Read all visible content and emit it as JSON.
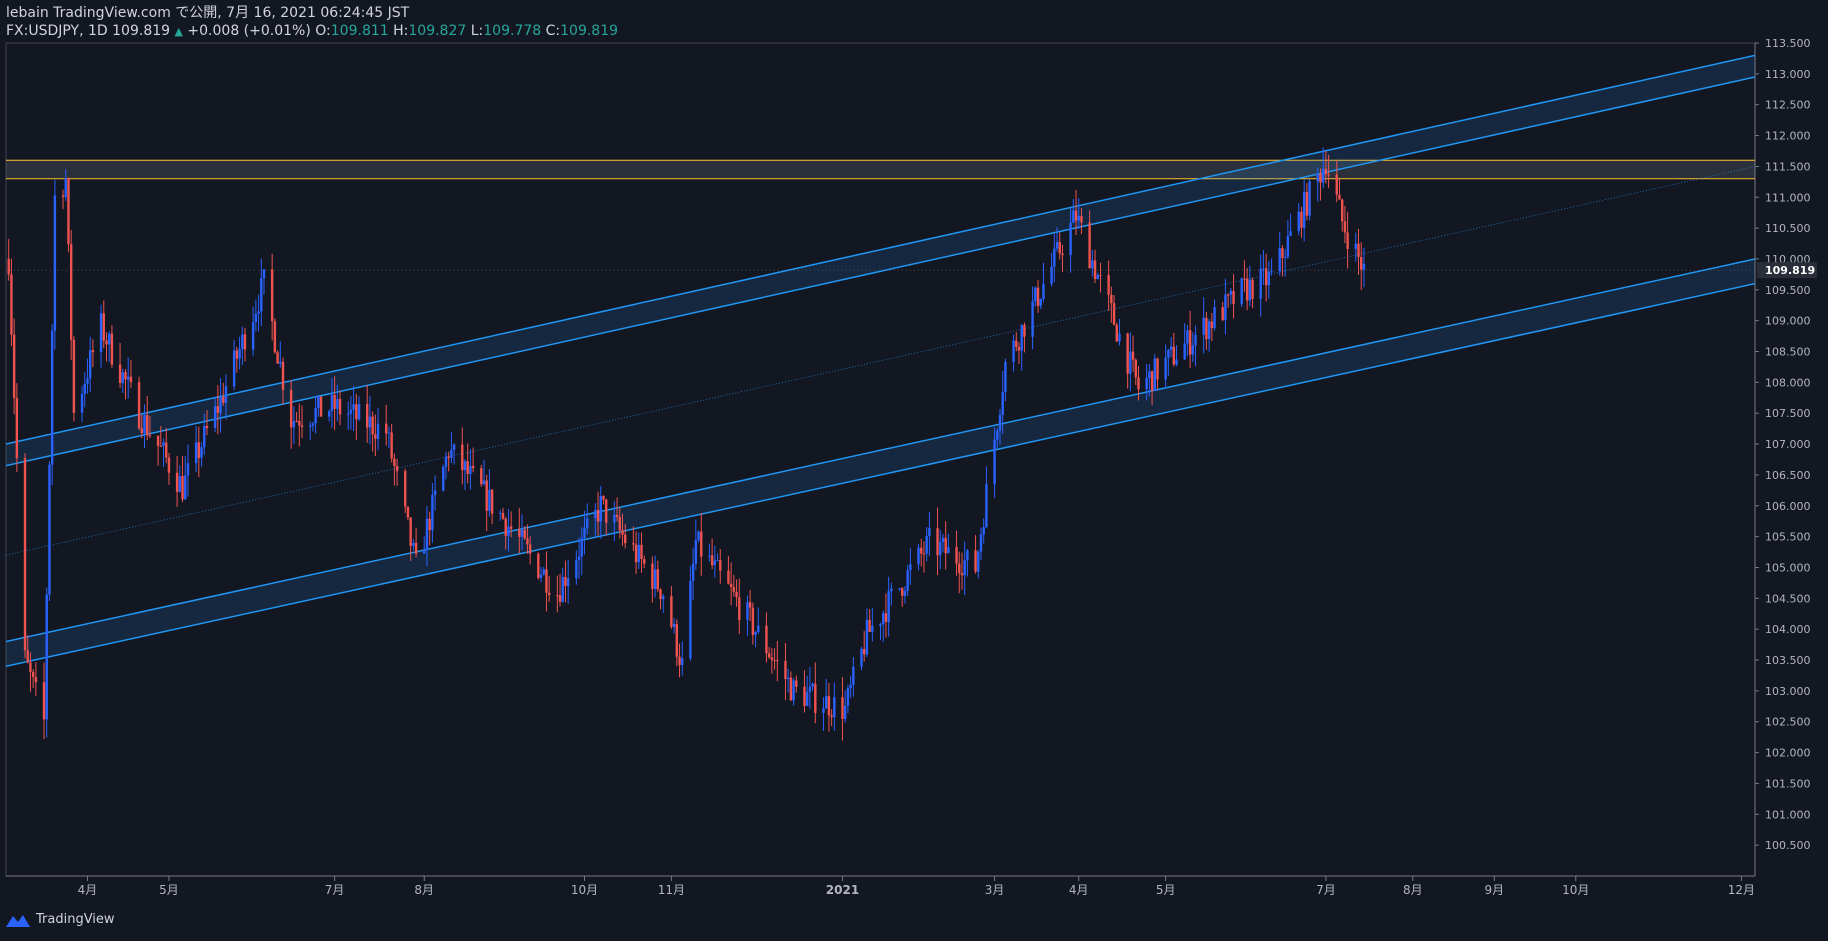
{
  "header": {
    "publisher": "lebain TradingView.com で公開, 7月 16, 2021 06:24:45 JST",
    "symbol_line": "FX:USDJPY, 1D",
    "last": "109.819",
    "change": "+0.008 (+0.01%)",
    "open_label": "O:",
    "open": "109.811",
    "high_label": "H:",
    "high": "109.827",
    "low_label": "L:",
    "low": "109.778",
    "close_label": "C:",
    "close": "109.819"
  },
  "footer": {
    "brand": "TradingView"
  },
  "colors": {
    "background": "#131722",
    "up": "#2962ff",
    "down": "#ef5350",
    "channel": "#2196f3",
    "resistance": "#fbc02d",
    "grid_text": "#b2b5be"
  },
  "chart_data": {
    "type": "candlestick",
    "symbol": "FX:USDJPY",
    "interval": "1D",
    "last_price_label": "109.819",
    "y_axis": {
      "min": 100.0,
      "max": 113.5,
      "ticks": [
        "100.500",
        "101.000",
        "101.500",
        "102.000",
        "102.500",
        "103.000",
        "103.500",
        "104.000",
        "104.500",
        "105.000",
        "105.500",
        "106.000",
        "106.500",
        "107.000",
        "107.500",
        "108.000",
        "108.500",
        "109.000",
        "109.500",
        "110.000",
        "110.500",
        "111.000",
        "111.500",
        "112.000",
        "112.500",
        "113.000",
        "113.500"
      ]
    },
    "x_axis": {
      "start": "2020-03-02",
      "end": "2021-12-06",
      "ticks": [
        {
          "label": "4月",
          "date": "2020-04-01"
        },
        {
          "label": "5月",
          "date": "2020-05-01"
        },
        {
          "label": "7月",
          "date": "2020-07-01"
        },
        {
          "label": "8月",
          "date": "2020-08-03"
        },
        {
          "label": "10月",
          "date": "2020-10-01"
        },
        {
          "label": "11月",
          "date": "2020-11-02"
        },
        {
          "label": "2021",
          "date": "2021-01-04"
        },
        {
          "label": "3月",
          "date": "2021-03-01"
        },
        {
          "label": "4月",
          "date": "2021-04-01"
        },
        {
          "label": "5月",
          "date": "2021-05-03"
        },
        {
          "label": "7月",
          "date": "2021-07-01"
        },
        {
          "label": "8月",
          "date": "2021-08-02"
        },
        {
          "label": "9月",
          "date": "2021-09-01"
        },
        {
          "label": "10月",
          "date": "2021-10-01"
        },
        {
          "label": "12月",
          "date": "2021-12-01"
        }
      ]
    },
    "price_path": [
      {
        "date": "2020-03-03",
        "close": 110.0
      },
      {
        "date": "2020-03-09",
        "close": 103.5
      },
      {
        "date": "2020-03-16",
        "close": 102.5
      },
      {
        "date": "2020-03-20",
        "close": 111.0
      },
      {
        "date": "2020-03-24",
        "close": 111.3
      },
      {
        "date": "2020-03-27",
        "close": 107.5
      },
      {
        "date": "2020-04-06",
        "close": 108.9
      },
      {
        "date": "2020-04-20",
        "close": 107.5
      },
      {
        "date": "2020-05-06",
        "close": 106.3
      },
      {
        "date": "2020-05-20",
        "close": 107.7
      },
      {
        "date": "2020-06-05",
        "close": 109.6
      },
      {
        "date": "2020-06-15",
        "close": 107.4
      },
      {
        "date": "2020-07-01",
        "close": 107.6
      },
      {
        "date": "2020-07-20",
        "close": 107.2
      },
      {
        "date": "2020-07-31",
        "close": 105.0
      },
      {
        "date": "2020-08-12",
        "close": 106.9
      },
      {
        "date": "2020-09-01",
        "close": 105.8
      },
      {
        "date": "2020-09-21",
        "close": 104.6
      },
      {
        "date": "2020-10-07",
        "close": 106.0
      },
      {
        "date": "2020-10-30",
        "close": 104.6
      },
      {
        "date": "2020-11-06",
        "close": 103.4
      },
      {
        "date": "2020-11-11",
        "close": 105.4
      },
      {
        "date": "2020-11-30",
        "close": 104.2
      },
      {
        "date": "2020-12-17",
        "close": 103.0
      },
      {
        "date": "2021-01-05",
        "close": 102.7
      },
      {
        "date": "2021-01-13",
        "close": 103.9
      },
      {
        "date": "2021-02-05",
        "close": 105.4
      },
      {
        "date": "2021-02-22",
        "close": 105.0
      },
      {
        "date": "2021-03-05",
        "close": 108.3
      },
      {
        "date": "2021-03-31",
        "close": 110.7
      },
      {
        "date": "2021-04-23",
        "close": 107.9
      },
      {
        "date": "2021-05-10",
        "close": 108.6
      },
      {
        "date": "2021-06-01",
        "close": 109.5
      },
      {
        "date": "2021-06-11",
        "close": 109.7
      },
      {
        "date": "2021-07-01",
        "close": 111.6
      },
      {
        "date": "2021-07-07",
        "close": 110.6
      },
      {
        "date": "2021-07-15",
        "close": 109.819
      }
    ],
    "annotations": [
      {
        "type": "horizontal_zone",
        "from": 111.3,
        "to": 111.6,
        "color": "#fbc02d"
      },
      {
        "type": "parallel_channel",
        "start": {
          "date": "2020-03-02",
          "price": 107.0
        },
        "end": {
          "date": "2021-12-06",
          "price": 113.3
        },
        "width": 0.35,
        "midline": {
          "start": 105.2,
          "end": 111.5
        }
      },
      {
        "type": "parallel_channel",
        "start": {
          "date": "2020-03-02",
          "price": 103.8
        },
        "end": {
          "date": "2021-12-06",
          "price": 110.0
        },
        "width": 0.4
      }
    ]
  }
}
